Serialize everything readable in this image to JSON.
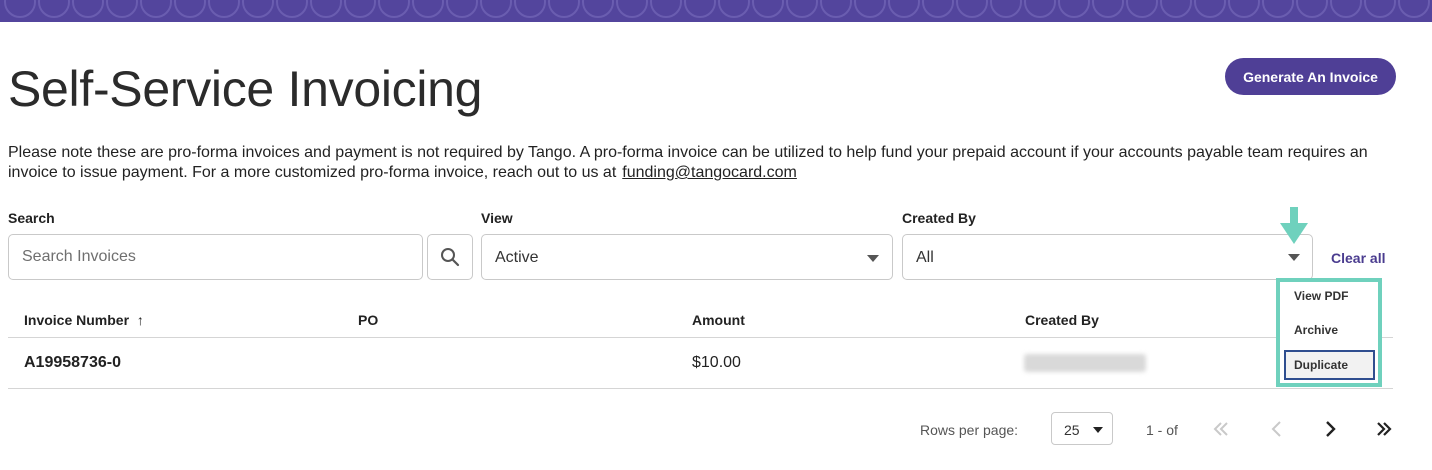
{
  "page": {
    "title": "Self-Service Invoicing",
    "generate_button": "Generate An Invoice",
    "notice_text": "Please note these are pro-forma invoices and payment is not required by Tango. A pro-forma invoice can be utilized to help fund your prepaid account if your accounts payable team requires an invoice to issue payment. For a more customized pro-forma invoice, reach out to us at",
    "notice_email": "funding@tangocard.com"
  },
  "filters": {
    "search_label": "Search",
    "search_placeholder": "Search Invoices",
    "view_label": "View",
    "view_value": "Active",
    "created_by_label": "Created By",
    "created_by_value": "All",
    "clear_all": "Clear all"
  },
  "table": {
    "columns": [
      "Invoice Number",
      "PO",
      "Amount",
      "Created By"
    ],
    "sort_indicator": "↑",
    "rows": [
      {
        "invoice_number": "A19958736-0",
        "po": "",
        "amount": "$10.00"
      }
    ]
  },
  "row_menu": {
    "items": [
      "View PDF",
      "Archive",
      "Duplicate"
    ]
  },
  "pagination": {
    "rows_per_page_label": "Rows per page:",
    "rows_per_page_value": "25",
    "range": "1 - of"
  },
  "colors": {
    "brand": "#4f3f96",
    "highlight": "#6fd1bd",
    "focus_border": "#2f4e8f"
  },
  "icons": [
    "search-icon",
    "chevron-down-icon",
    "sort-arrow-up-icon",
    "first-page-icon",
    "prev-page-icon",
    "next-page-icon",
    "last-page-icon",
    "down-arrow-pointer-icon"
  ]
}
